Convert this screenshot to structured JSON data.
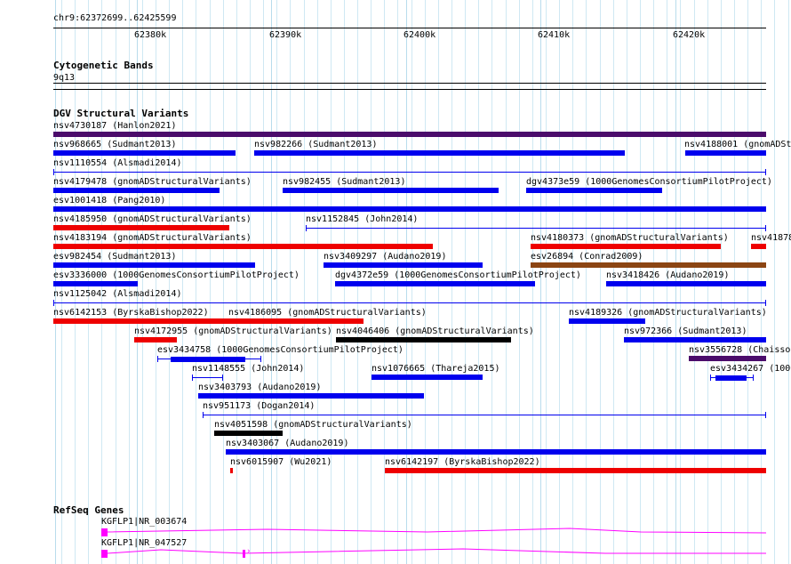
{
  "ruler": {
    "range_label": "chr9:62372699..62425599",
    "ticks": [
      "62380k",
      "62390k",
      "62400k",
      "62410k",
      "62420k"
    ]
  },
  "cyto": {
    "title": "Cytogenetic Bands",
    "band": "9q13"
  },
  "dgv": {
    "title": "DGV Structural Variants",
    "colors": {
      "blue": "#0000ee",
      "red": "#ee0000",
      "purple": "#4b0c6b",
      "black": "#000000",
      "brown": "#8b4513"
    },
    "items": [
      {
        "label": "nsv4730187 (Hanlon2021)",
        "color": "purple",
        "style": "solid"
      },
      {
        "label": "nsv968665 (Sudmant2013)",
        "color": "blue",
        "style": "solid"
      },
      {
        "label": "nsv982266 (Sudmant2013)",
        "color": "blue",
        "style": "solid"
      },
      {
        "label": "nsv4188001 (gnomADStr",
        "color": "blue",
        "style": "solid"
      },
      {
        "label": "nsv1110554 (Alsmadi2014)",
        "color": "blue",
        "style": "thin"
      },
      {
        "label": "nsv4179478 (gnomADStructuralVariants)",
        "color": "blue",
        "style": "solid"
      },
      {
        "label": "nsv982455 (Sudmant2013)",
        "color": "blue",
        "style": "solid"
      },
      {
        "label": "dgv4373e59 (1000GenomesConsortiumPilotProject)",
        "color": "blue",
        "style": "solid"
      },
      {
        "label": "esv1001418 (Pang2010)",
        "color": "blue",
        "style": "solid"
      },
      {
        "label": "nsv4185950 (gnomADStructuralVariants)",
        "color": "red",
        "style": "solid"
      },
      {
        "label": "nsv1152845 (John2014)",
        "color": "blue",
        "style": "thin"
      },
      {
        "label": "nsv4183194 (gnomADStructuralVariants)",
        "color": "red",
        "style": "solid"
      },
      {
        "label": "nsv4180373 (gnomADStructuralVariants)",
        "color": "red",
        "style": "solid"
      },
      {
        "label": "nsv41878",
        "color": "red",
        "style": "solid"
      },
      {
        "label": "esv982454 (Sudmant2013)",
        "color": "blue",
        "style": "solid"
      },
      {
        "label": "nsv3409297 (Audano2019)",
        "color": "blue",
        "style": "solid"
      },
      {
        "label": "esv26894 (Conrad2009)",
        "color": "brown",
        "style": "solid"
      },
      {
        "label": "esv3336000 (1000GenomesConsortiumPilotProject)",
        "color": "blue",
        "style": "solid"
      },
      {
        "label": "dgv4372e59 (1000GenomesConsortiumPilotProject)",
        "color": "blue",
        "style": "solid"
      },
      {
        "label": "nsv3418426 (Audano2019)",
        "color": "blue",
        "style": "solid"
      },
      {
        "label": "nsv1125042 (Alsmadi2014)",
        "color": "blue",
        "style": "thin"
      },
      {
        "label": "nsv6142153 (ByrskaBishop2022)",
        "color": "red",
        "style": "solid"
      },
      {
        "label": "nsv4186095 (gnomADStructuralVariants)",
        "color": "red",
        "style": "solid"
      },
      {
        "label": "nsv4189326 (gnomADStructuralVariants)",
        "color": "blue",
        "style": "solid"
      },
      {
        "label": "nsv4172955 (gnomADStructuralVariants)",
        "color": "red",
        "style": "solid"
      },
      {
        "label": "nsv4046406 (gnomADStructuralVariants)",
        "color": "black",
        "style": "solid"
      },
      {
        "label": "nsv972366 (Sudmant2013)",
        "color": "blue",
        "style": "solid"
      },
      {
        "label": "esv3434758 (1000GenomesConsortiumPilotProject)",
        "color": "blue",
        "style": "gapped"
      },
      {
        "label": "nsv3556728 (Chaisson",
        "color": "purple",
        "style": "solid"
      },
      {
        "label": "nsv1148555 (John2014)",
        "color": "blue",
        "style": "thin"
      },
      {
        "label": "nsv1076665 (Thareja2015)",
        "color": "blue",
        "style": "solid"
      },
      {
        "label": "esv3434267 (1000",
        "color": "blue",
        "style": "gapped"
      },
      {
        "label": "nsv3403793 (Audano2019)",
        "color": "blue",
        "style": "solid"
      },
      {
        "label": "nsv951173 (Dogan2014)",
        "color": "blue",
        "style": "thin"
      },
      {
        "label": "nsv4051598 (gnomADStructuralVariants)",
        "color": "black",
        "style": "solid"
      },
      {
        "label": "nsv3403067 (Audano2019)",
        "color": "blue",
        "style": "solid"
      },
      {
        "label": "nsv6015907 (Wu2021)",
        "color": "red",
        "style": "solid"
      },
      {
        "label": "nsv6142197 (ByrskaBishop2022)",
        "color": "red",
        "style": "solid"
      }
    ]
  },
  "refseq": {
    "title": "RefSeq Genes",
    "color": "#ff00ff",
    "genes": [
      {
        "label": "KGFLP1|NR_003674"
      },
      {
        "label": "KGFLP1|NR_047527"
      }
    ]
  }
}
